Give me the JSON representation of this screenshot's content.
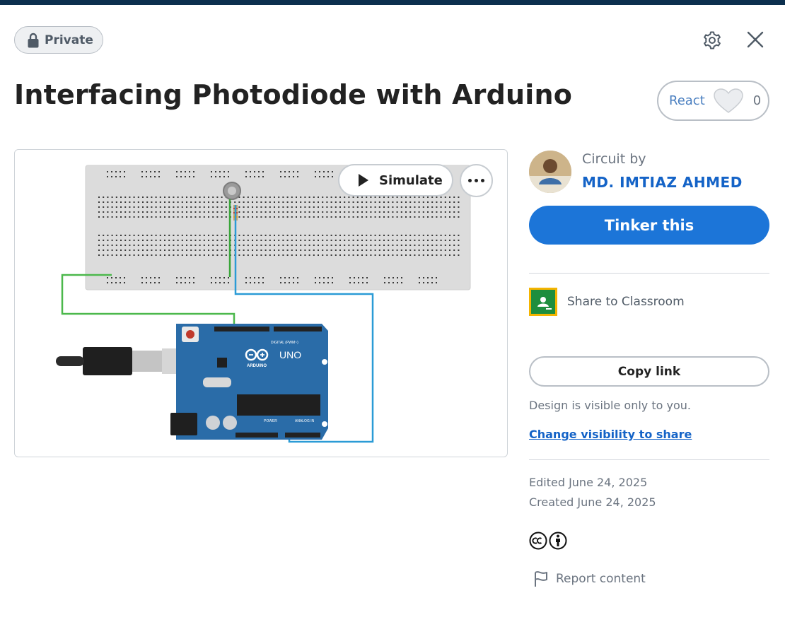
{
  "header": {
    "visibility_badge": "Private",
    "badge_icon": "lock-icon",
    "settings_icon": "gear-icon",
    "close_icon": "close-icon"
  },
  "title": "Interfacing Photodiode with Arduino",
  "react": {
    "label": "React",
    "icon": "heart-icon",
    "count": "0"
  },
  "preview": {
    "simulate_label": "Simulate",
    "simulate_icon": "play-icon",
    "more_icon": "more-icon",
    "board_label": "UNO",
    "board_brand": "ARDUINO",
    "header_labels": {
      "digital": "DIGITAL (PWM~)",
      "power": "POWER",
      "analog": "ANALOG IN"
    },
    "wire_colors": {
      "ground": "#4cb84c",
      "signal": "#2b9bd6",
      "probe": "#3aa53a"
    }
  },
  "sidebar": {
    "circuit_by_label": "Circuit by",
    "author": "MD. IMTIAZ AHMED",
    "tinker_label": "Tinker this",
    "share_classroom_label": "Share to Classroom",
    "copy_link_label": "Copy link",
    "visibility_note": "Design is visible only to you.",
    "change_visibility_label": "Change visibility to share",
    "edited": "Edited June 24, 2025",
    "created": "Created June 24, 2025",
    "license_icons": [
      "cc-icon",
      "attribution-icon"
    ],
    "report_label": "Report content",
    "report_icon": "flag-icon"
  },
  "colors": {
    "primary": "#1c75d8",
    "link": "#1463c7",
    "topbar": "#0c2f4e",
    "board": "#2a6ca8"
  }
}
